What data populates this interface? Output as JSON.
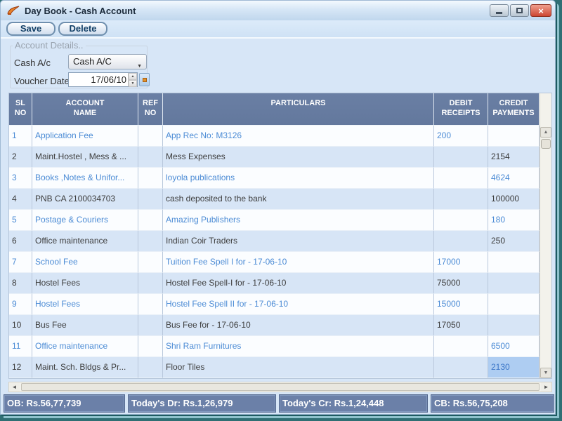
{
  "window": {
    "title": "Day Book - Cash Account"
  },
  "icons": {
    "close": "×",
    "dropdown_arrow": "▼",
    "spinner_up": "▲",
    "spinner_down": "▼",
    "scroll_up": "▲",
    "scroll_down": "▼",
    "scroll_left": "◄",
    "scroll_right": "►"
  },
  "toolbar": {
    "save_label": "Save",
    "delete_label": "Delete"
  },
  "account_details": {
    "group_label": "Account Details..",
    "cash_ac_label": "Cash A/c",
    "cash_ac_value": "Cash A/C",
    "voucher_date_label": "Voucher Date",
    "voucher_date_value": "17/06/10"
  },
  "table": {
    "columns": [
      {
        "label": "SL\nNO"
      },
      {
        "label": "ACCOUNT\nNAME"
      },
      {
        "label": "REF\nNO"
      },
      {
        "label": "PARTICULARS"
      },
      {
        "label": "DEBIT\nRECEIPTS"
      },
      {
        "label": "CREDIT\nPAYMENTS"
      }
    ],
    "rows": [
      {
        "sl": "1",
        "account": "Application Fee",
        "ref": "",
        "particulars": "App Rec No: M3126",
        "debit": "200",
        "credit": ""
      },
      {
        "sl": "2",
        "account": "Maint.Hostel , Mess & ...",
        "ref": "",
        "particulars": "Mess Expenses",
        "debit": "",
        "credit": "2154"
      },
      {
        "sl": "3",
        "account": "Books ,Notes & Unifor...",
        "ref": "",
        "particulars": "loyola publications",
        "debit": "",
        "credit": "4624"
      },
      {
        "sl": "4",
        "account": "PNB CA 2100034703",
        "ref": "",
        "particulars": "cash deposited to the bank",
        "debit": "",
        "credit": "100000"
      },
      {
        "sl": "5",
        "account": "Postage & Couriers",
        "ref": "",
        "particulars": "Amazing Publishers",
        "debit": "",
        "credit": "180"
      },
      {
        "sl": "6",
        "account": "Office maintenance",
        "ref": "",
        "particulars": "Indian Coir Traders",
        "debit": "",
        "credit": "250"
      },
      {
        "sl": "7",
        "account": "School Fee",
        "ref": "",
        "particulars": "Tuition Fee Spell I for - 17-06-10",
        "debit": "17000",
        "credit": ""
      },
      {
        "sl": "8",
        "account": "Hostel Fees",
        "ref": "",
        "particulars": "Hostel Fee Spell-I for - 17-06-10",
        "debit": "75000",
        "credit": ""
      },
      {
        "sl": "9",
        "account": "Hostel Fees",
        "ref": "",
        "particulars": "Hostel Fee Spell II for - 17-06-10",
        "debit": "15000",
        "credit": ""
      },
      {
        "sl": "10",
        "account": "Bus Fee",
        "ref": "",
        "particulars": "Bus Fee for - 17-06-10",
        "debit": "17050",
        "credit": ""
      },
      {
        "sl": "11",
        "account": "Office maintenance",
        "ref": "",
        "particulars": "Shri Ram Furnitures",
        "debit": "",
        "credit": "6500"
      },
      {
        "sl": "12",
        "account": "Maint. Sch. Bldgs & Pr...",
        "ref": "",
        "particulars": "Floor Tiles",
        "debit": "",
        "credit": "2130",
        "selected_cell": "credit"
      }
    ]
  },
  "status": {
    "panels": [
      "OB: Rs.56,77,739",
      "Today's Dr: Rs.1,26,979",
      "Today's Cr: Rs.1,24,448",
      "CB: Rs.56,75,208"
    ]
  },
  "colors": {
    "header_bg": "#6a7fa4",
    "row_bg": "#fbfdff",
    "row_alt_bg": "#d7e5f6",
    "blue_text": "#4b8bd5",
    "dark_text": "#3d3d3d",
    "selected_cell_bg": "#aecdf2",
    "status_bg": "#6b80a8",
    "desktop_teal": "#2f6f74",
    "close_red": "#cc4632"
  }
}
